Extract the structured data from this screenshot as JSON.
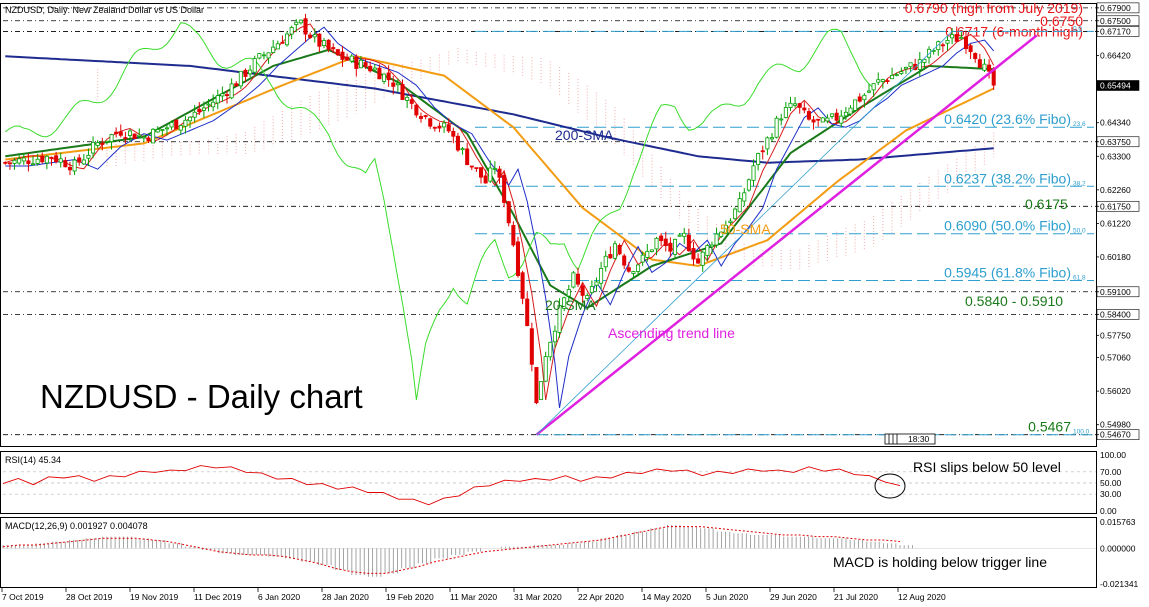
{
  "header": {
    "main": "NZDUSD, Daily:  New Zealand Dollar vs US Dollar",
    "rsi": "RSI(14) 45.34",
    "macd": "MACD(12,26,9) 0.001927 0.004078",
    "time_box": "18:30"
  },
  "annotations": {
    "title": "NZDUSD - Daily chart",
    "sma200": "200-SMA",
    "sma50": "50-SMA",
    "sma20": "20-SMA",
    "trend": "Ascending trend line",
    "rsi_note": "RSI slips below 50 level",
    "macd_note": "MACD is holding below trigger line",
    "level_6175": "0.6175",
    "range_5840_5910": "0.5840 - 0.5910"
  },
  "red_levels": [
    {
      "value": 0.679,
      "label": "0.6790 (high from July 2019)"
    },
    {
      "value": 0.675,
      "label": "0.6750"
    },
    {
      "value": 0.6717,
      "label": "0.6717 (6-month high)"
    }
  ],
  "fibo": [
    {
      "value": 0.6717,
      "small": "0.0",
      "label": ""
    },
    {
      "value": 0.642,
      "small": "23.6",
      "label": "0.6420 (23.6% Fibo)"
    },
    {
      "value": 0.6237,
      "small": "38.2",
      "label": "0.6237 (38.2% Fibo)"
    },
    {
      "value": 0.609,
      "small": "50.0",
      "label": "0.6090 (50.0% Fibo)"
    },
    {
      "value": 0.5945,
      "small": "61.8",
      "label": "0.5945 (61.8% Fibo)"
    },
    {
      "value": 0.5467,
      "small": "100.0",
      "label": "0.5467"
    }
  ],
  "colors": {
    "candle_up": "#00a000",
    "candle_down": "#e00000",
    "sma200": "#1e2b8f",
    "sma50": "#f39c12",
    "sma20": "#1a7a1a",
    "tenkan": "#d81b1b",
    "kijun": "#1f2fc8",
    "chikou": "#3bdc2c",
    "cloud": "#f3b8b8",
    "trend": "#e020e0",
    "fibo": "#2e9fcf",
    "rsi": "#e00000",
    "macd_signal": "#e00000",
    "macd_hist": "#9a9a9a"
  },
  "chart_data": [
    {
      "type": "candlestick",
      "title": "NZDUSD, Daily:  New Zealand Dollar vs US Dollar",
      "ylim": [
        0.5432,
        0.6802
      ],
      "y_ticks": [
        "0.67900",
        "0.67500",
        "0.67170",
        "0.66420",
        "0.65494",
        "0.64340",
        "0.63750",
        "0.63300",
        "0.62260",
        "0.61750",
        "0.61220",
        "0.60180",
        "0.59100",
        "0.58400",
        "0.57750",
        "0.57060",
        "0.56020",
        "0.54980",
        "0.54670"
      ],
      "x_ticks": [
        "7 Oct 2019",
        "28 Oct 2019",
        "19 Nov 2019",
        "11 Dec 2019",
        "6 Jan 2020",
        "28 Jan 2020",
        "19 Feb 2020",
        "11 Mar 2020",
        "31 Mar 2020",
        "22 Apr 2020",
        "14 May 2020",
        "5 Jun 2020",
        "29 Jun 2020",
        "21 Jul 2020",
        "12 Aug 2020"
      ],
      "last_price": 0.65494,
      "horizontal_levels": [
        0.679,
        0.675,
        0.6717,
        0.6375,
        0.6175,
        0.591,
        0.584,
        0.5467
      ],
      "close_path": [
        [
          0,
          0.631
        ],
        [
          10,
          0.633
        ],
        [
          15,
          0.63
        ],
        [
          20,
          0.637
        ],
        [
          25,
          0.641
        ],
        [
          30,
          0.639
        ],
        [
          35,
          0.642
        ],
        [
          40,
          0.645
        ],
        [
          45,
          0.65
        ],
        [
          50,
          0.656
        ],
        [
          54,
          0.662
        ],
        [
          58,
          0.667
        ],
        [
          62,
          0.672
        ],
        [
          64,
          0.674
        ],
        [
          67,
          0.669
        ],
        [
          72,
          0.664
        ],
        [
          76,
          0.662
        ],
        [
          80,
          0.66
        ],
        [
          84,
          0.656
        ],
        [
          88,
          0.649
        ],
        [
          92,
          0.644
        ],
        [
          96,
          0.641
        ],
        [
          100,
          0.632
        ],
        [
          104,
          0.625
        ],
        [
          106,
          0.63
        ],
        [
          108,
          0.62
        ],
        [
          110,
          0.606
        ],
        [
          112,
          0.59
        ],
        [
          114,
          0.57
        ],
        [
          115,
          0.556
        ],
        [
          117,
          0.572
        ],
        [
          120,
          0.585
        ],
        [
          123,
          0.595
        ],
        [
          126,
          0.588
        ],
        [
          129,
          0.598
        ],
        [
          132,
          0.606
        ],
        [
          135,
          0.598
        ],
        [
          138,
          0.601
        ],
        [
          141,
          0.607
        ],
        [
          144,
          0.604
        ],
        [
          147,
          0.608
        ],
        [
          150,
          0.6
        ],
        [
          153,
          0.607
        ],
        [
          156,
          0.612
        ],
        [
          159,
          0.618
        ],
        [
          162,
          0.63
        ],
        [
          165,
          0.638
        ],
        [
          168,
          0.646
        ],
        [
          171,
          0.649
        ],
        [
          174,
          0.644
        ],
        [
          177,
          0.643
        ],
        [
          180,
          0.645
        ],
        [
          183,
          0.649
        ],
        [
          186,
          0.652
        ],
        [
          189,
          0.656
        ],
        [
          192,
          0.658
        ],
        [
          195,
          0.66
        ],
        [
          198,
          0.662
        ],
        [
          201,
          0.666
        ],
        [
          204,
          0.669
        ],
        [
          207,
          0.67
        ],
        [
          210,
          0.665
        ],
        [
          212,
          0.66
        ],
        [
          214,
          0.6549
        ]
      ],
      "sma200_path": [
        [
          0,
          0.664
        ],
        [
          40,
          0.661
        ],
        [
          80,
          0.654
        ],
        [
          110,
          0.646
        ],
        [
          130,
          0.639
        ],
        [
          150,
          0.633
        ],
        [
          165,
          0.631
        ],
        [
          185,
          0.632
        ],
        [
          214,
          0.6355
        ]
      ],
      "sma50_path": [
        [
          0,
          0.632
        ],
        [
          30,
          0.637
        ],
        [
          60,
          0.655
        ],
        [
          76,
          0.664
        ],
        [
          95,
          0.658
        ],
        [
          110,
          0.642
        ],
        [
          125,
          0.617
        ],
        [
          140,
          0.601
        ],
        [
          150,
          0.599
        ],
        [
          165,
          0.607
        ],
        [
          180,
          0.625
        ],
        [
          195,
          0.641
        ],
        [
          214,
          0.654
        ]
      ],
      "sma20_path": [
        [
          0,
          0.633
        ],
        [
          30,
          0.639
        ],
        [
          58,
          0.661
        ],
        [
          70,
          0.666
        ],
        [
          85,
          0.656
        ],
        [
          100,
          0.64
        ],
        [
          110,
          0.615
        ],
        [
          118,
          0.593
        ],
        [
          126,
          0.586
        ],
        [
          140,
          0.599
        ],
        [
          155,
          0.606
        ],
        [
          170,
          0.634
        ],
        [
          185,
          0.648
        ],
        [
          200,
          0.661
        ],
        [
          214,
          0.66
        ]
      ],
      "trend_line": [
        [
          115,
          0.5467
        ],
        [
          219,
          0.668
        ]
      ]
    },
    {
      "type": "line",
      "title": "RSI(14) 45.34",
      "ylim": [
        0,
        100
      ],
      "y_ticks": [
        "100.00",
        "70.00",
        "50.00",
        "30.00",
        "0.00"
      ],
      "levels": [
        70,
        50,
        30
      ],
      "values": [
        52,
        55,
        50,
        58,
        62,
        60,
        56,
        60,
        64,
        68,
        72,
        70,
        75,
        78,
        80,
        76,
        72,
        65,
        60,
        55,
        50,
        46,
        42,
        40,
        36,
        30,
        24,
        18,
        14,
        20,
        30,
        40,
        48,
        52,
        56,
        55,
        58,
        60,
        56,
        58,
        62,
        66,
        70,
        72,
        74,
        70,
        66,
        68,
        70,
        72,
        74,
        70,
        72,
        76,
        74,
        72,
        68,
        60,
        52,
        45.34
      ]
    },
    {
      "type": "bar",
      "title": "MACD(12,26,9) 0.001927 0.004078",
      "ylim": [
        -0.021341,
        0.015763
      ],
      "y_ticks": [
        "0.015763",
        "0.000000",
        "-0.021341"
      ],
      "histogram": [
        0.002,
        0.002,
        0.003,
        0.004,
        0.005,
        0.006,
        0.007,
        0.007,
        0.006,
        0.005,
        0.003,
        0.001,
        -0.001,
        -0.003,
        -0.004,
        -0.004,
        -0.005,
        -0.006,
        -0.008,
        -0.01,
        -0.013,
        -0.016,
        -0.017,
        -0.015,
        -0.012,
        -0.009,
        -0.006,
        -0.004,
        -0.002,
        0.0,
        0.001,
        0.001,
        0.002,
        0.002,
        0.003,
        0.004,
        0.006,
        0.008,
        0.01,
        0.012,
        0.014,
        0.013,
        0.012,
        0.01,
        0.009,
        0.008,
        0.008,
        0.007,
        0.007,
        0.006,
        0.006,
        0.005,
        0.004,
        0.003,
        0.0019
      ],
      "signal": [
        0.001,
        0.002,
        0.002,
        0.003,
        0.004,
        0.005,
        0.006,
        0.006,
        0.006,
        0.005,
        0.004,
        0.002,
        0.0,
        -0.002,
        -0.003,
        -0.004,
        -0.004,
        -0.005,
        -0.007,
        -0.009,
        -0.012,
        -0.014,
        -0.015,
        -0.015,
        -0.013,
        -0.011,
        -0.008,
        -0.006,
        -0.004,
        -0.002,
        -0.001,
        0.0,
        0.001,
        0.002,
        0.003,
        0.004,
        0.005,
        0.007,
        0.009,
        0.011,
        0.013,
        0.013,
        0.013,
        0.012,
        0.011,
        0.01,
        0.009,
        0.008,
        0.008,
        0.007,
        0.007,
        0.006,
        0.005,
        0.005,
        0.0041
      ]
    }
  ]
}
